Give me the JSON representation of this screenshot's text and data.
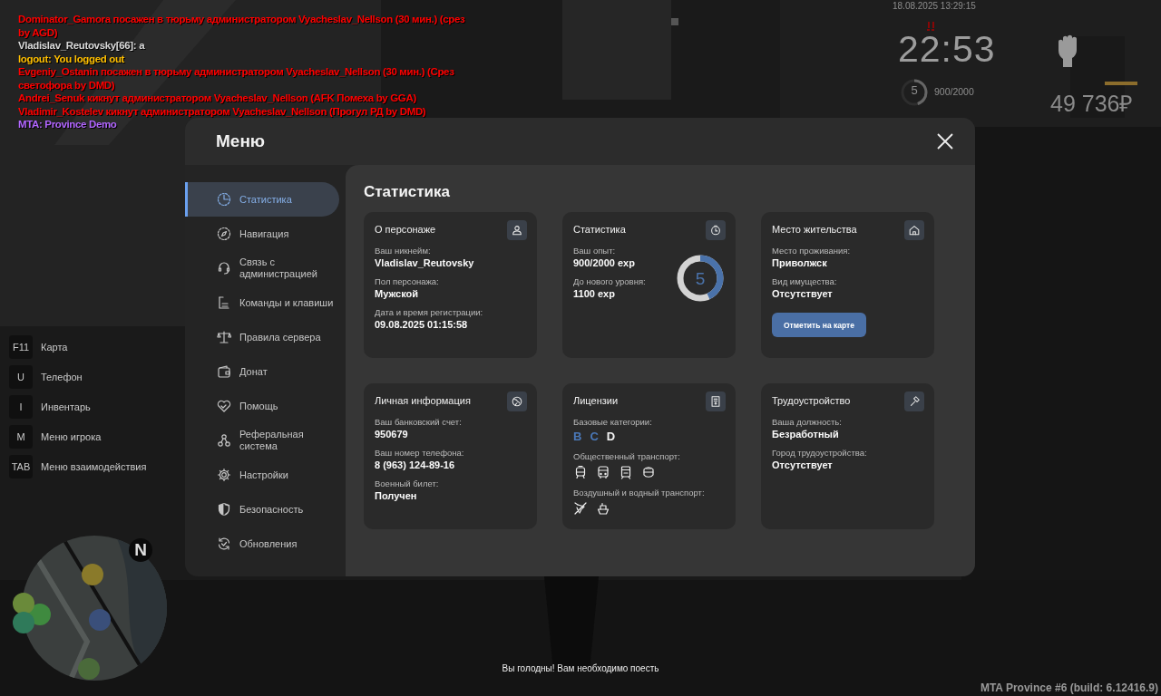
{
  "chat": [
    {
      "text": "Dominator_Gamora посажен в тюрьму администратором Vyacheslav_Nellson (30 мин.) (срез by AGD)",
      "color": "#ff0000"
    },
    {
      "text": "Vladislav_Reutovsky[66]: a",
      "color": "#d9d9d9"
    },
    {
      "text": "logout: You logged out",
      "color": "#ffbf00"
    },
    {
      "text": "Evgeniy_Ostanin посажен в тюрьму администратором Vyacheslav_Nellson (30 мин.) (Срез светофора by DMD)",
      "color": "#ff0000"
    },
    {
      "text": "Andrei_Senuk кикнут администратором Vyacheslav_Nellson (AFK Помеха by GGA)",
      "color": "#ff0000"
    },
    {
      "text": "Vladimir_Kostelev кикнут администратором Vyacheslav_Nellson (Прогул РД by DMD)",
      "color": "#ff0000"
    },
    {
      "text": "MTA: Province Demo",
      "color": "#b266ff"
    }
  ],
  "hud": {
    "date": "18.08.2025 13:29:15",
    "time": "22:53",
    "player_level": "5",
    "xp_ring": {
      "level": 0.45
    },
    "exp": "900/2000",
    "status_bar": {
      "level": 1
    },
    "money": "49 736₽"
  },
  "key_hints": [
    {
      "key": "F11",
      "label": "Карта"
    },
    {
      "key": "U",
      "label": "Телефон"
    },
    {
      "key": "I",
      "label": "Инвентарь"
    },
    {
      "key": "M",
      "label": "Меню игрока"
    },
    {
      "key": "TAB",
      "label": "Меню взаимодействия"
    }
  ],
  "minimap": {
    "compass": "N"
  },
  "notice": "Вы голодны! Вам необходимо поесть",
  "build": "MTA Province #6 (build: 6.12416.9)",
  "menu": {
    "title": "Меню",
    "nav": [
      {
        "label": "Статистика",
        "selected": true
      },
      {
        "label": "Навигация",
        "selected": false
      },
      {
        "label": "Связь с администрацией",
        "selected": false
      },
      {
        "label": "Команды и клавиши",
        "selected": false
      },
      {
        "label": "Правила сервера",
        "selected": false
      },
      {
        "label": "Донат",
        "selected": false
      },
      {
        "label": "Помощь",
        "selected": false
      },
      {
        "label": "Реферальная система",
        "selected": false
      },
      {
        "label": "Настройки",
        "selected": false
      },
      {
        "label": "Безопасность",
        "selected": false
      },
      {
        "label": "Обновления",
        "selected": false
      }
    ],
    "section_title": "Статистика",
    "cards": [
      {
        "kind": "info",
        "title": "О персонаже",
        "fields": [
          {
            "label": "Ваш никнейм:",
            "value": "Vladislav_Reutovsky"
          },
          {
            "label": "Пол персонажа:",
            "value": "Мужской"
          },
          {
            "label": "Дата и время регистрации:",
            "value": "09.08.2025 01:15:58"
          }
        ]
      },
      {
        "kind": "progress",
        "title": "Статистика",
        "fields": [
          {
            "label": "Ваш опыт:",
            "value": "900/2000 exp"
          },
          {
            "label": "До нового уровня:",
            "value": "1100 exp"
          }
        ],
        "ring": {
          "value": "5",
          "level": 0.43
        }
      },
      {
        "kind": "action",
        "title": "Место жительства",
        "fields": [
          {
            "label": "Место проживания:",
            "value": "Приволжск"
          },
          {
            "label": "Вид имущества:",
            "value": "Отсутствует"
          }
        ],
        "button": "Отметить на карте"
      },
      {
        "kind": "info",
        "title": "Личная информация",
        "fields": [
          {
            "label": "Ваш банковский счет:",
            "value": "950679"
          },
          {
            "label": "Ваш номер телефона:",
            "value": "8 (963) 124-89-16"
          },
          {
            "label": "Военный билет:",
            "value": "Получен"
          }
        ]
      },
      {
        "kind": "licenses",
        "title": "Лицензии",
        "categories_label": "Базовые категории:",
        "categories": [
          {
            "letter": "B",
            "active": true
          },
          {
            "letter": "C",
            "active": true
          },
          {
            "letter": "D",
            "active": false
          }
        ],
        "public_label": "Общественный транспорт:",
        "air_water_label": "Воздушный и водный транспорт:"
      },
      {
        "kind": "info",
        "title": "Трудоустройство",
        "fields": [
          {
            "label": "Ваша должность:",
            "value": "Безработный"
          },
          {
            "label": "Город трудоустройства:",
            "value": "Отсутствует"
          }
        ]
      }
    ]
  }
}
